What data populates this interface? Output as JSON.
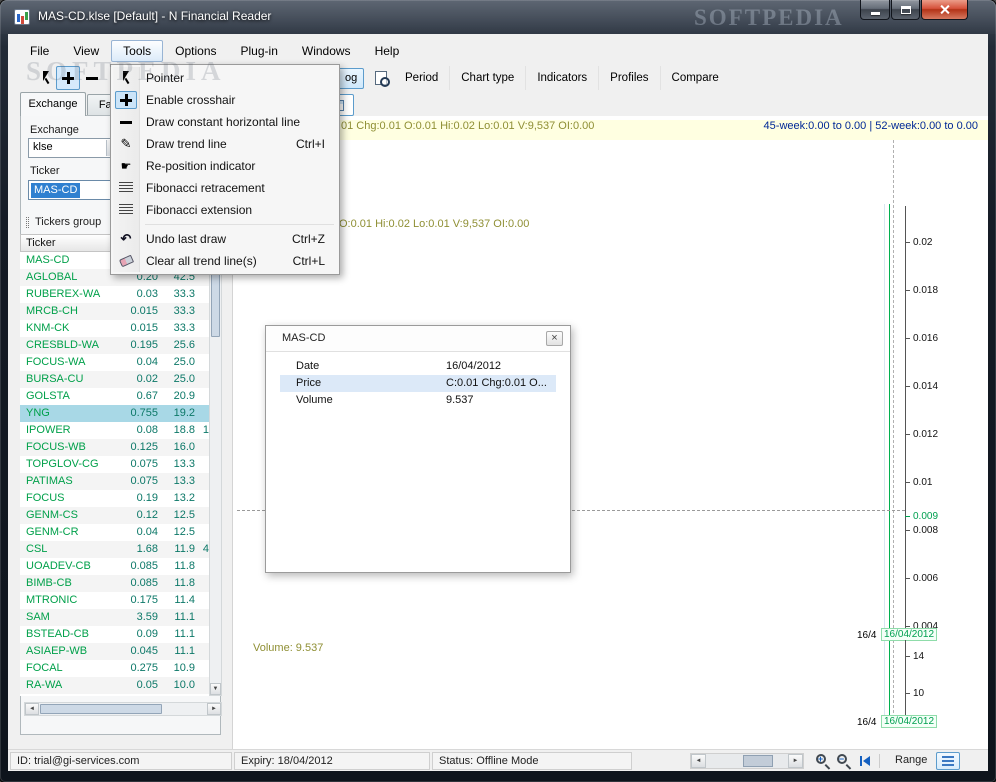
{
  "window": {
    "title": "MAS-CD.klse [Default] - N Financial Reader",
    "watermark": "SOFTPEDIA"
  },
  "menubar": {
    "items": [
      {
        "label": "File"
      },
      {
        "label": "View"
      },
      {
        "label": "Tools",
        "active": true
      },
      {
        "label": "Options"
      },
      {
        "label": "Plug-in"
      },
      {
        "label": "Windows"
      },
      {
        "label": "Help"
      }
    ]
  },
  "tools_menu": {
    "items_main": [
      {
        "label": "Pointer",
        "shortcut": "",
        "icon": "pointer-icon"
      },
      {
        "label": "Enable crosshair",
        "shortcut": "",
        "icon": "crosshair-icon",
        "checked": true
      },
      {
        "label": "Draw constant horizontal line",
        "shortcut": "",
        "icon": "horizontal-line-icon"
      },
      {
        "label": "Draw trend line",
        "shortcut": "Ctrl+I",
        "icon": "pencil-icon"
      },
      {
        "label": "Re-position indicator",
        "shortcut": "",
        "icon": "hand-icon"
      },
      {
        "label": "Fibonacci retracement",
        "shortcut": "",
        "icon": "fib-retracement-icon"
      },
      {
        "label": "Fibonacci extension",
        "shortcut": "",
        "icon": "fib-extension-icon"
      }
    ],
    "items_edit": [
      {
        "label": "Undo last draw",
        "shortcut": "Ctrl+Z",
        "icon": "undo-icon"
      },
      {
        "label": "Clear all trend line(s)",
        "shortcut": "Ctrl+L",
        "icon": "eraser-icon"
      }
    ]
  },
  "toolbar": {
    "log_button_label": "og",
    "buttons": [
      {
        "label": "Period"
      },
      {
        "label": "Chart type"
      },
      {
        "label": "Indicators"
      },
      {
        "label": "Profiles"
      },
      {
        "label": "Compare"
      }
    ]
  },
  "sidebar": {
    "tabs": [
      {
        "label": "Exchange",
        "active": true
      },
      {
        "label": "Fav"
      }
    ],
    "exchange_label": "Exchange",
    "exchange_value": "klse",
    "ticker_label": "Ticker",
    "ticker_value": "MAS-CD",
    "group_header": "Tickers group",
    "table": {
      "header": "Ticker",
      "rows": [
        {
          "ticker": "MAS-CD",
          "price": "",
          "chg": "",
          "extra": ""
        },
        {
          "ticker": "AGLOBAL",
          "price": "0.20",
          "chg": "42.5",
          "extra": ""
        },
        {
          "ticker": "RUBEREX-WA",
          "price": "0.03",
          "chg": "33.3",
          "extra": ""
        },
        {
          "ticker": "MRCB-CH",
          "price": "0.015",
          "chg": "33.3",
          "extra": ""
        },
        {
          "ticker": "KNM-CK",
          "price": "0.015",
          "chg": "33.3",
          "extra": ""
        },
        {
          "ticker": "CRESBLD-WA",
          "price": "0.195",
          "chg": "25.6",
          "extra": ""
        },
        {
          "ticker": "FOCUS-WA",
          "price": "0.04",
          "chg": "25.0",
          "extra": ""
        },
        {
          "ticker": "BURSA-CU",
          "price": "0.02",
          "chg": "25.0",
          "extra": ""
        },
        {
          "ticker": "GOLSTA",
          "price": "0.67",
          "chg": "20.9",
          "extra": ""
        },
        {
          "ticker": "YNG",
          "price": "0.755",
          "chg": "19.2",
          "extra": "",
          "selected": true
        },
        {
          "ticker": "IPOWER",
          "price": "0.08",
          "chg": "18.8",
          "extra": "1"
        },
        {
          "ticker": "FOCUS-WB",
          "price": "0.125",
          "chg": "16.0",
          "extra": ""
        },
        {
          "ticker": "TOPGLOV-CG",
          "price": "0.075",
          "chg": "13.3",
          "extra": ""
        },
        {
          "ticker": "PATIMAS",
          "price": "0.075",
          "chg": "13.3",
          "extra": ""
        },
        {
          "ticker": "FOCUS",
          "price": "0.19",
          "chg": "13.2",
          "extra": ""
        },
        {
          "ticker": "GENM-CS",
          "price": "0.12",
          "chg": "12.5",
          "extra": ""
        },
        {
          "ticker": "GENM-CR",
          "price": "0.04",
          "chg": "12.5",
          "extra": ""
        },
        {
          "ticker": "CSL",
          "price": "1.68",
          "chg": "11.9",
          "extra": "4"
        },
        {
          "ticker": "UOADEV-CB",
          "price": "0.085",
          "chg": "11.8",
          "extra": ""
        },
        {
          "ticker": "BIMB-CB",
          "price": "0.085",
          "chg": "11.8",
          "extra": ""
        },
        {
          "ticker": "MTRONIC",
          "price": "0.175",
          "chg": "11.4",
          "extra": ""
        },
        {
          "ticker": "SAM",
          "price": "3.59",
          "chg": "11.1",
          "extra": ""
        },
        {
          "ticker": "BSTEAD-CB",
          "price": "0.09",
          "chg": "11.1",
          "extra": ""
        },
        {
          "ticker": "ASIAEP-WB",
          "price": "0.045",
          "chg": "11.1",
          "extra": ""
        },
        {
          "ticker": "FOCAL",
          "price": "0.275",
          "chg": "10.9",
          "extra": ""
        },
        {
          "ticker": "RA-WA",
          "price": "0.05",
          "chg": "10.0",
          "extra": ""
        }
      ]
    }
  },
  "chart": {
    "quote_strip": "01 Chg:0.01 O:0.01 Hi:0.02 Lo:0.01 V:9,537 OI:0.00",
    "week_range": "45-week:0.00 to 0.00 | 52-week:0.00 to 0.00",
    "quote_line": "O:0.01 Hi:0.02 Lo:0.01 V:9,537 OI:0.00",
    "price_axis": [
      "0.02",
      "0.018",
      "0.016",
      "0.014",
      "0.012",
      "0.01",
      "0.008",
      "0.006",
      "0.004"
    ],
    "crosshair_price": "0.009",
    "date_short": "16/4",
    "date_full": "16/04/2012",
    "volume_label": "Volume: 9.537",
    "volume_axis": [
      "14",
      "10"
    ]
  },
  "info_window": {
    "title": "MAS-CD",
    "rows": [
      {
        "label": "Date",
        "value": "16/04/2012"
      },
      {
        "label": "Price",
        "value": "C:0.01 Chg:0.01 O...",
        "highlight": true
      },
      {
        "label": "Volume",
        "value": "9.537"
      }
    ]
  },
  "statusbar": {
    "id": "ID: trial@gi-services.com",
    "expiry": "Expiry: 18/04/2012",
    "status": "Status: Offline Mode",
    "range_label": "Range"
  }
}
